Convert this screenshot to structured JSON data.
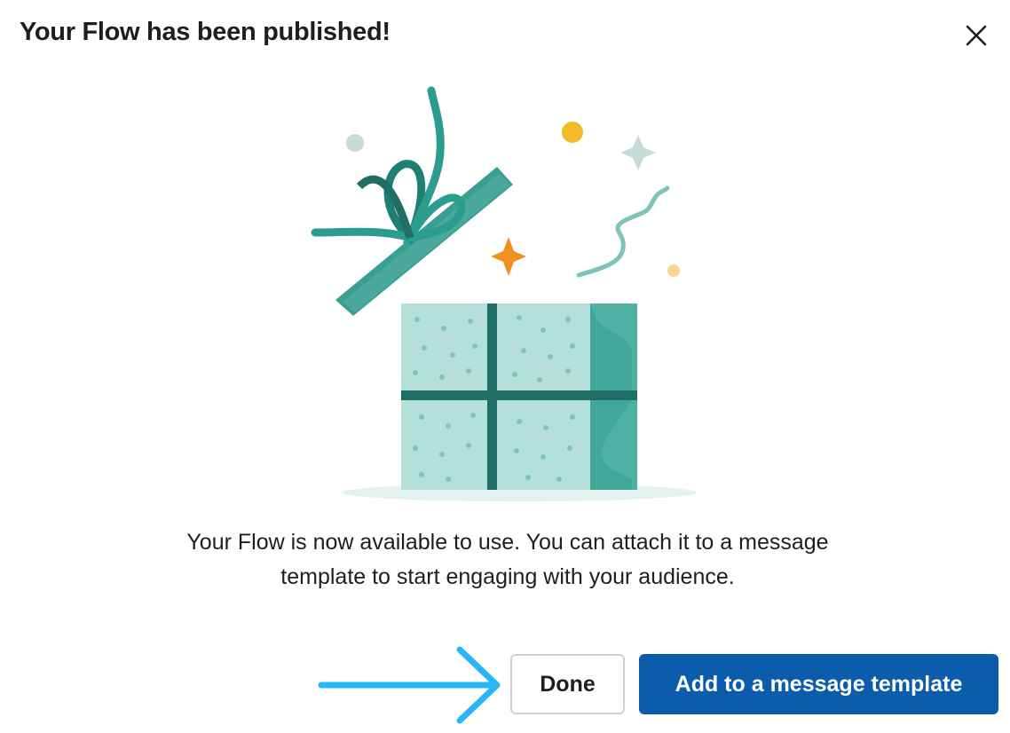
{
  "dialog": {
    "title": "Your Flow has been published!",
    "close_icon": "close-icon",
    "message": "Your Flow is now available to use. You can attach it to a message template to start engaging with your audience.",
    "buttons": {
      "done_label": "Done",
      "add_template_label": "Add to a message template"
    },
    "illustration": "gift-box-illustration"
  },
  "colors": {
    "primary_button": "#0b5cab",
    "annotation_arrow": "#29b6f6",
    "gift_teal": "#2a9d8f",
    "gift_light": "#a8dcd4",
    "confetti_orange": "#f0901e",
    "confetti_yellow": "#f5b92a"
  }
}
